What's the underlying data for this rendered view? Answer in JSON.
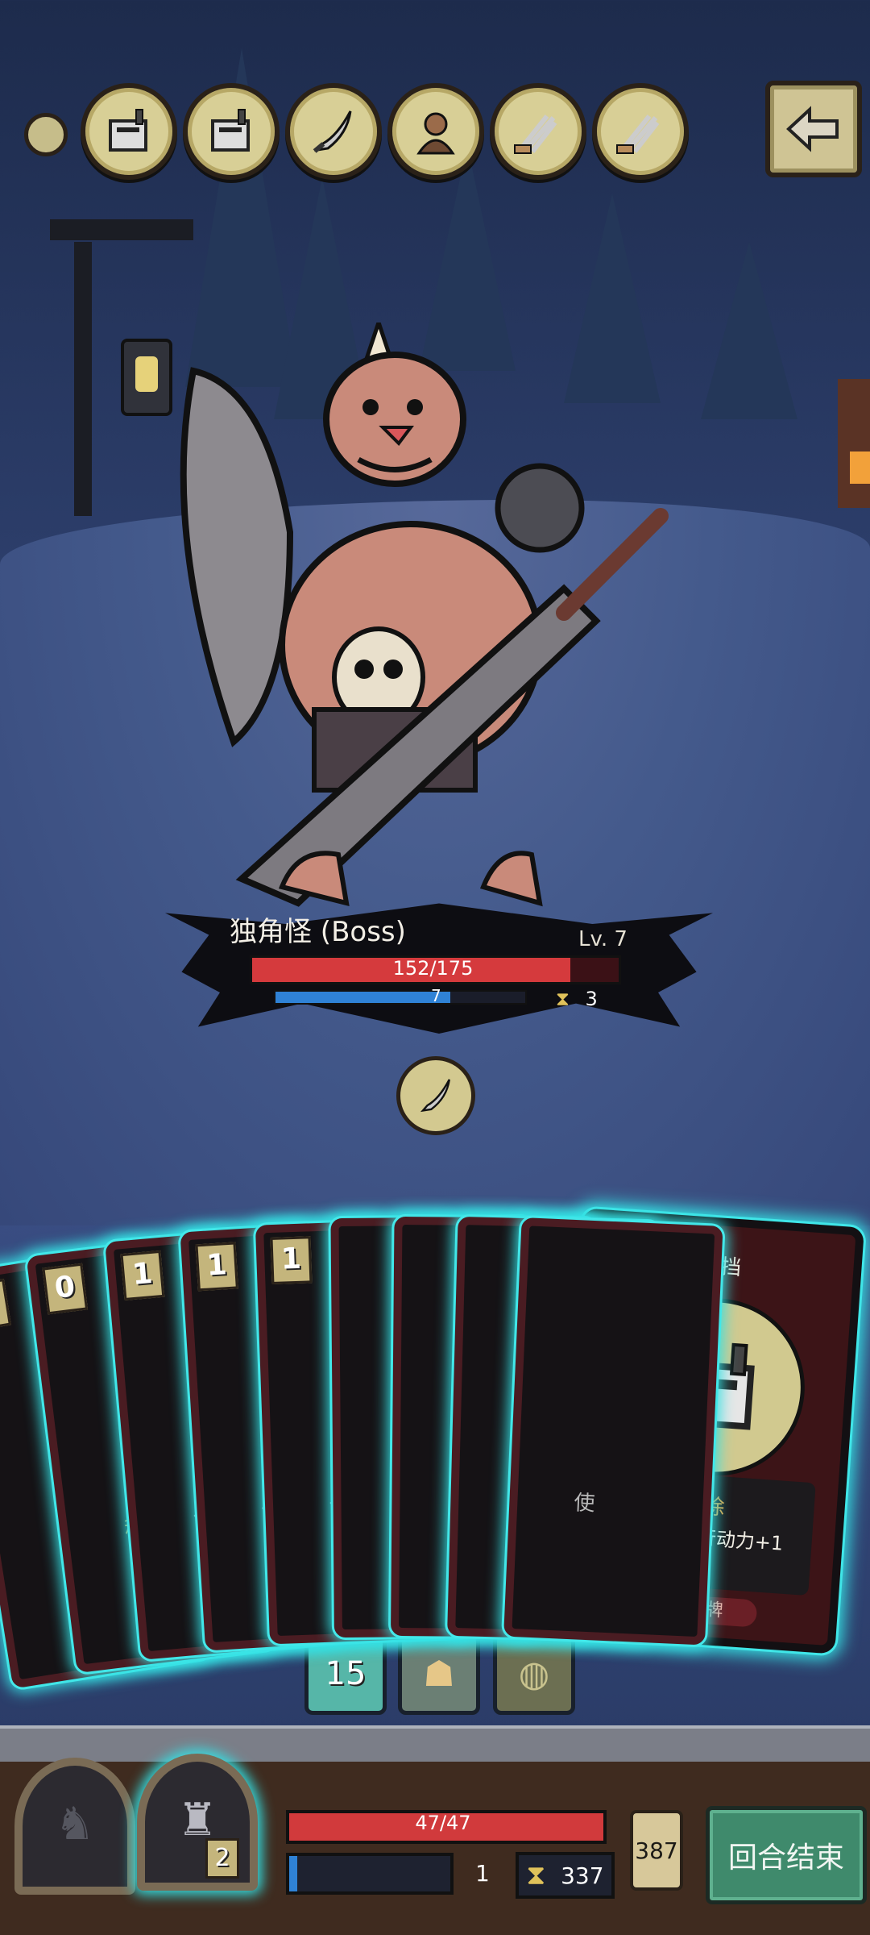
{
  "relics": [
    {
      "icon": "safe-box-icon"
    },
    {
      "icon": "safe-box-icon"
    },
    {
      "icon": "curved-sword-icon"
    },
    {
      "icon": "brute-warrior-icon"
    },
    {
      "icon": "trident-icon"
    },
    {
      "icon": "trident-icon"
    }
  ],
  "boss": {
    "name": "独角怪 (Boss)",
    "level": "Lv. 7",
    "hp_text": "152/175",
    "hp_fraction": 0.869,
    "mana_text": "7",
    "mana_fraction": 0.7,
    "turns": "3",
    "intent_icon": "curved-sword-icon"
  },
  "hand": {
    "cards": [
      {
        "cost": "0",
        "stub": ""
      },
      {
        "cost": "0",
        "stub": "移除",
        "stub_color": "#e0a843"
      },
      {
        "cost": "1",
        "stub": "使"
      },
      {
        "cost": "1",
        "stub": "使"
      },
      {
        "cost": "1",
        "stub": "使"
      },
      {
        "cost": "",
        "stub": "使"
      },
      {
        "cost": "",
        "stub": ""
      },
      {
        "cost": "",
        "stub": ""
      },
      {
        "cost": "",
        "stub": "使"
      }
    ],
    "featured": {
      "title": "换挡",
      "keyword": "移除",
      "description": "本次战斗行动力+1",
      "type_tag": "攻击牌",
      "icon": "safe-box-icon"
    }
  },
  "piles": {
    "draw_count": "15"
  },
  "player": {
    "hp_text": "47/47",
    "hp_fraction": 1.0,
    "energy_fraction": 0.05,
    "energy_value": "1",
    "turn_timer": "337",
    "gold": "387",
    "portrait_badge": "2",
    "end_turn_label": "回合结束"
  },
  "colors": {
    "hp": "#d53a3d",
    "mana": "#2f82d6",
    "card_glow": "#35e1e4",
    "end_turn": "#3f8a6c"
  }
}
